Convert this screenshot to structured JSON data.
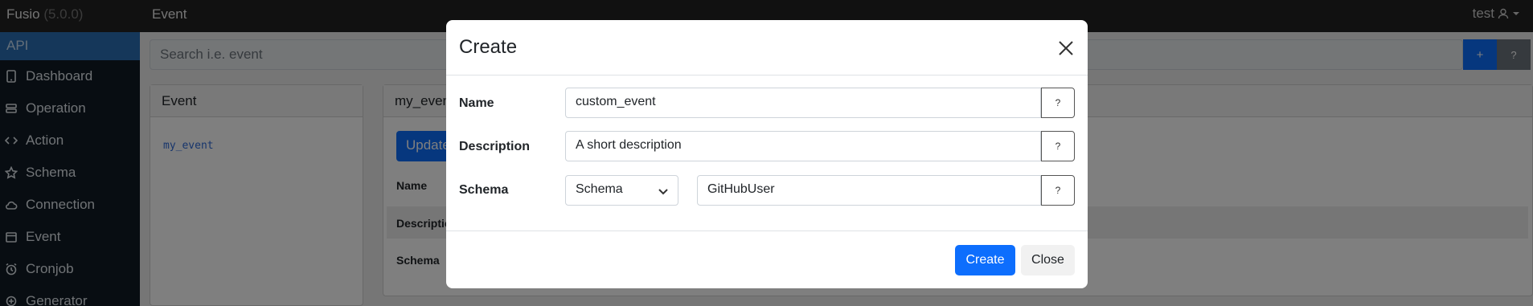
{
  "topbar": {
    "brand": "Fusio",
    "version": "(5.0.0)",
    "page_title": "Event",
    "user": "test"
  },
  "sidebar": {
    "header": "API",
    "items": [
      {
        "label": "Dashboard",
        "icon": "tablet-icon"
      },
      {
        "label": "Operation",
        "icon": "operation-icon"
      },
      {
        "label": "Action",
        "icon": "code-icon"
      },
      {
        "label": "Schema",
        "icon": "star-icon"
      },
      {
        "label": "Connection",
        "icon": "cloud-icon"
      },
      {
        "label": "Event",
        "icon": "calendar-icon"
      },
      {
        "label": "Cronjob",
        "icon": "alarm-icon"
      },
      {
        "label": "Generator",
        "icon": "generator-icon"
      }
    ]
  },
  "search": {
    "placeholder": "Search i.e. event",
    "plus_label": "+",
    "help_label": "?"
  },
  "event_list": {
    "header": "Event",
    "items": [
      "my_event"
    ]
  },
  "detail": {
    "header": "my_event",
    "update_label": "Update",
    "rows": [
      "Name",
      "Description",
      "Schema"
    ]
  },
  "modal": {
    "title": "Create",
    "fields": {
      "name_label": "Name",
      "name_value": "custom_event",
      "description_label": "Description",
      "description_value": "A short description",
      "schema_label": "Schema",
      "schema_type": "Schema",
      "schema_value": "GitHubUser",
      "help_label": "?"
    },
    "create_label": "Create",
    "close_label": "Close"
  },
  "colors": {
    "primary": "#0d6efd",
    "sidebar_bg": "#101a24",
    "sidebar_header": "#2a6fb4",
    "topbar_bg": "#222222"
  }
}
